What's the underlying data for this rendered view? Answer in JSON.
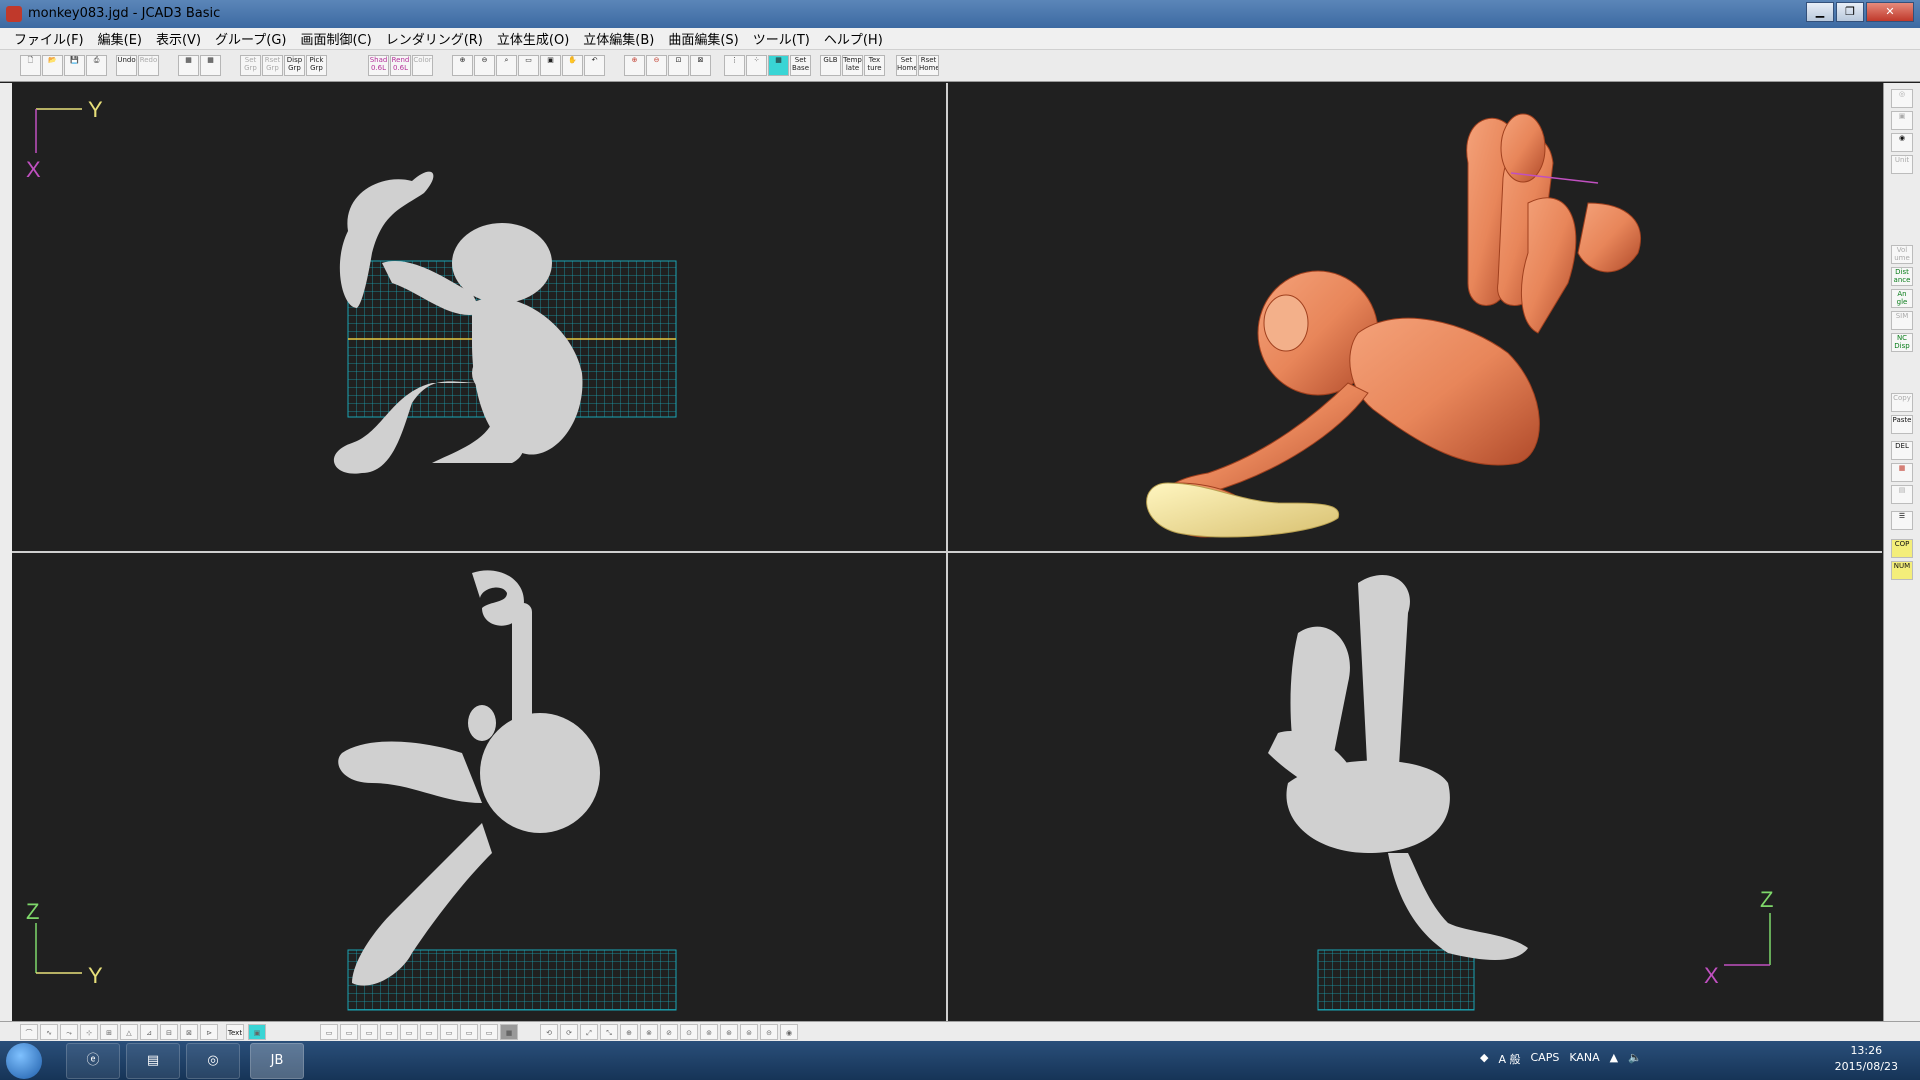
{
  "window": {
    "title": "monkey083.jgd - JCAD3 Basic"
  },
  "menu": [
    "ファイル(F)",
    "編集(E)",
    "表示(V)",
    "グループ(G)",
    "画面制御(C)",
    "レンダリング(R)",
    "立体生成(O)",
    "立体編集(B)",
    "曲面編集(S)",
    "ツール(T)",
    "ヘルプ(H)"
  ],
  "toolbar": {
    "undo": "Undo",
    "redo": "Redo",
    "set_grp": "Set Grp",
    "reset_grp": "Rset Grp",
    "disp_grp": "Disp Grp",
    "pick_grp": "Pick Grp",
    "shad": "Shad 0.6L",
    "rend": "Rend 0.6L",
    "color": "Color",
    "set_base": "Set Base",
    "glb": "GLB",
    "template": "Temp late",
    "texture": "Tex ture",
    "set_home": "Set Home",
    "rset_home": "Rset Home"
  },
  "viewports": {
    "top_left": {
      "axis_v": "Y",
      "axis_h": "X"
    },
    "bottom_left": {
      "axis_v": "Z",
      "axis_h": "Y"
    },
    "bottom_right": {
      "axis_v": "Z",
      "axis_h": "X"
    }
  },
  "right_panel": {
    "vol": "Vol ume",
    "distance": "Dist ance",
    "angle": "An gle",
    "sim": "SIM",
    "nc_disp": "NC Disp",
    "copy": "Copy",
    "paste": "Paste",
    "del": "DEL",
    "cop": "COP",
    "num": "NUM",
    "unit": "Unit"
  },
  "status": {
    "text": "Text"
  },
  "taskbar": {
    "app_label": "JB"
  },
  "tray": {
    "ime": "A 般",
    "caps": "CAPS",
    "kana": "KANA"
  },
  "clock": {
    "time": "13:26",
    "date": "2015/08/23"
  },
  "colors": {
    "monkey_render": "#e8865a",
    "banana": "#f3e8a0",
    "wireframe": "#d0d0d0",
    "grid": "#1aa5b5",
    "axis_y": "#e8e07a",
    "axis_x": "#c050c0",
    "axis_z": "#7ed86a"
  }
}
